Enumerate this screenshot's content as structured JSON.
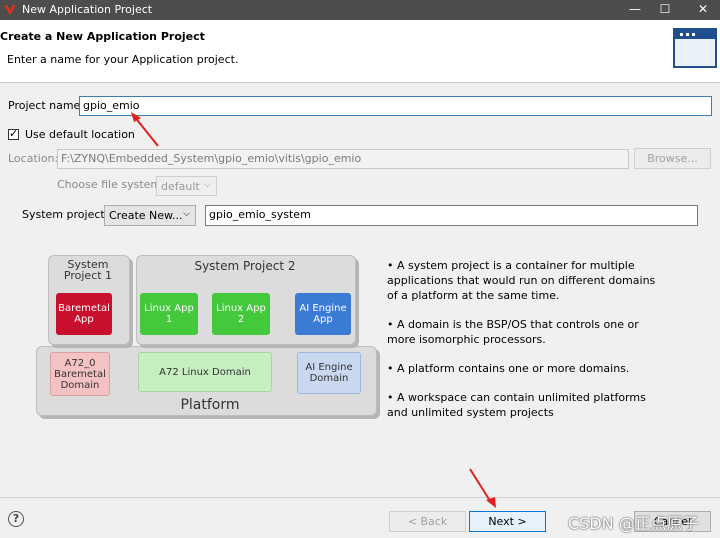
{
  "window": {
    "title": "New Application Project",
    "controls": [
      "—",
      "☐",
      "✕"
    ]
  },
  "header": {
    "title": "Create a New Application Project",
    "description": "Enter a name for your Application project."
  },
  "form": {
    "project_name_label": "Project name:",
    "project_name_value": "gpio_emio",
    "use_default_location_label": "Use default location",
    "use_default_location_checked": true,
    "location_label": "Location:",
    "location_value": "F:\\ZYNQ\\Embedded_System\\gpio_emio\\vitis\\gpio_emio",
    "browse_label": "Browse...",
    "file_system_label": "Choose file system:",
    "file_system_value": "default",
    "system_project_label": "System project:",
    "system_project_option": "Create New...",
    "system_project_name": "gpio_emio_system"
  },
  "diagram": {
    "system_project_1": "System Project 1",
    "system_project_2": "System Project 2",
    "baremetal_app": "Baremetal App",
    "linux_app_1": "Linux App 1",
    "linux_app_2": "Linux App 2",
    "ai_engine_app": "AI Engine App",
    "a72_baremetal_domain": "A72_0 Baremetal Domain",
    "a72_linux_domain": "A72 Linux Domain",
    "ai_engine_domain": "AI Engine Domain",
    "platform": "Platform",
    "colors": {
      "baremetal": "#c8102e",
      "linux": "#44c83c",
      "ai_engine": "#3a7bd5"
    }
  },
  "info": [
    "• A system project is a container for multiple applications that would run on different domains of a platform at the same time.",
    "• A domain is the BSP/OS that controls one or more isomorphic processors.",
    "• A platform contains one or more domains.",
    "• A workspace can contain unlimited platforms and unlimited system projects"
  ],
  "footer": {
    "help_icon": "?",
    "back_label": "< Back",
    "next_label": "Next >",
    "cancel_label": "Cancel",
    "watermark": "CSDN @正点原子"
  }
}
